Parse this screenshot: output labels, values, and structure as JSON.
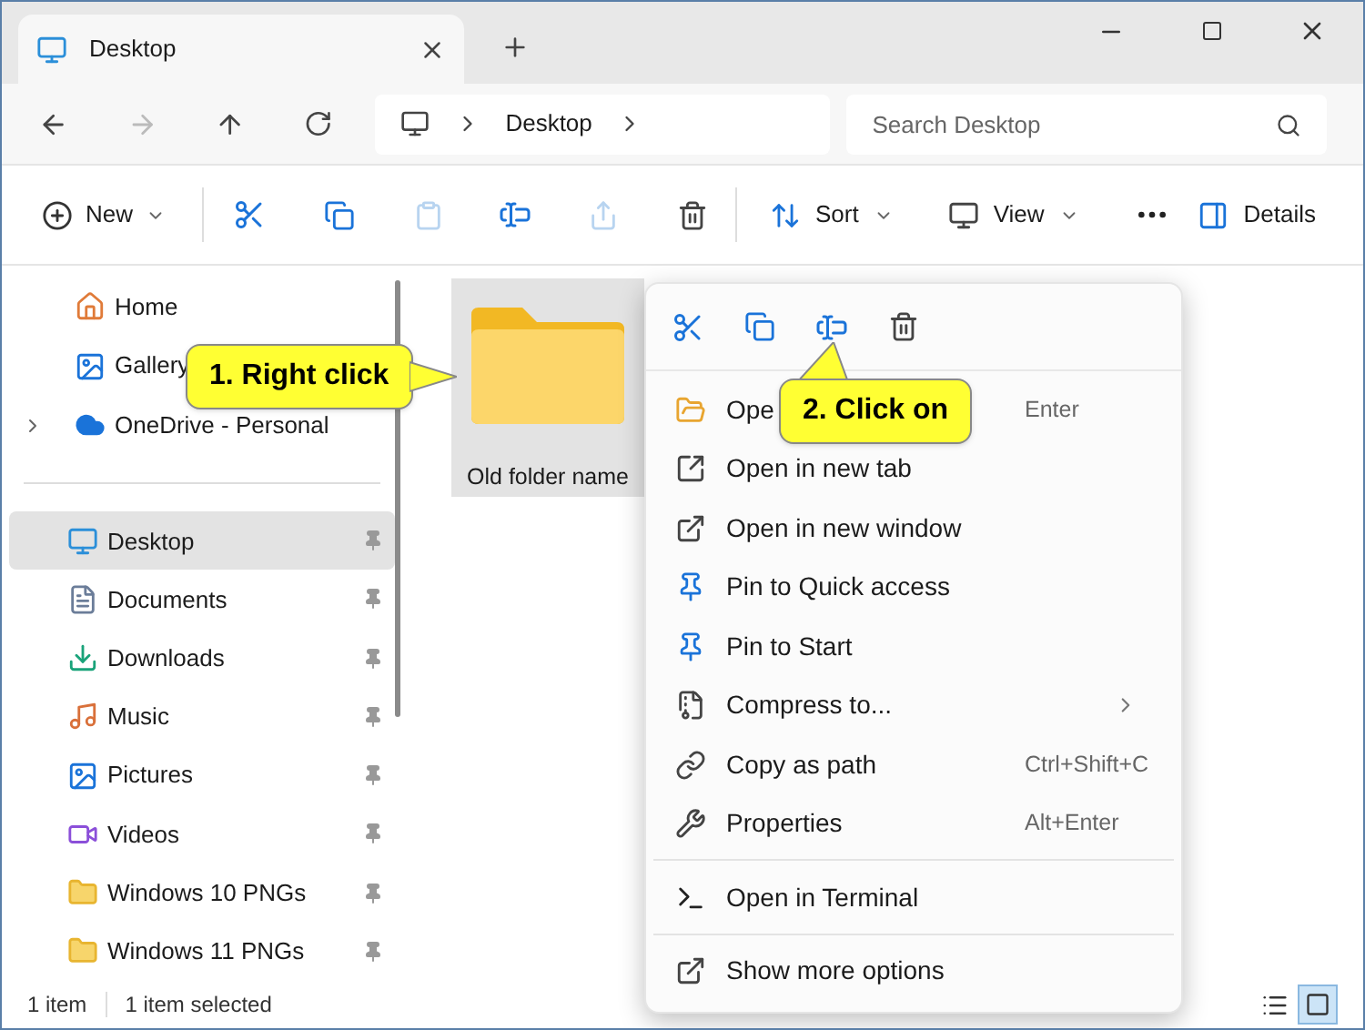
{
  "tabs": [
    {
      "label": "Desktop",
      "selected": true
    }
  ],
  "address": {
    "segments": [
      "Desktop"
    ]
  },
  "search": {
    "placeholder": "Search Desktop"
  },
  "toolbar": {
    "new_label": "New",
    "sort_label": "Sort",
    "view_label": "View",
    "details_label": "Details",
    "paste_disabled": true,
    "share_disabled": true
  },
  "sidebar": {
    "top_items": [
      {
        "label": "Home",
        "expandable": false
      },
      {
        "label": "Gallery",
        "expandable": false
      },
      {
        "label": "OneDrive - Personal",
        "expandable": true
      }
    ],
    "pinned_items": [
      {
        "label": "Desktop",
        "selected": true
      },
      {
        "label": "Documents",
        "selected": false
      },
      {
        "label": "Downloads",
        "selected": false
      },
      {
        "label": "Music",
        "selected": false
      },
      {
        "label": "Pictures",
        "selected": false
      },
      {
        "label": "Videos",
        "selected": false
      },
      {
        "label": "Windows 10 PNGs",
        "selected": false
      },
      {
        "label": "Windows 11 PNGs",
        "selected": false
      }
    ]
  },
  "files": [
    {
      "name": "Old folder name",
      "selected": true
    }
  ],
  "context_menu": {
    "groups": [
      [
        {
          "label": "Ope",
          "shortcut": "Enter",
          "submenu": false
        },
        {
          "label": "Open in new tab",
          "submenu": false
        },
        {
          "label": "Open in new window",
          "submenu": false
        },
        {
          "label": "Pin to Quick access",
          "submenu": false
        },
        {
          "label": "Pin to Start",
          "submenu": false
        },
        {
          "label": "Compress to...",
          "submenu": true
        },
        {
          "label": "Copy as path",
          "shortcut": "Ctrl+Shift+C",
          "submenu": false
        },
        {
          "label": "Properties",
          "shortcut": "Alt+Enter",
          "submenu": false
        }
      ],
      [
        {
          "label": "Open in Terminal",
          "submenu": false
        }
      ],
      [
        {
          "label": "Show more options",
          "submenu": false
        }
      ]
    ]
  },
  "callouts": [
    {
      "text": "1. Right click"
    },
    {
      "text": "2. Click on"
    }
  ],
  "status_bar": {
    "texts": [
      "1 item",
      "1 item selected"
    ],
    "view_modes": [
      {
        "selected": false
      },
      {
        "selected": true
      }
    ]
  }
}
